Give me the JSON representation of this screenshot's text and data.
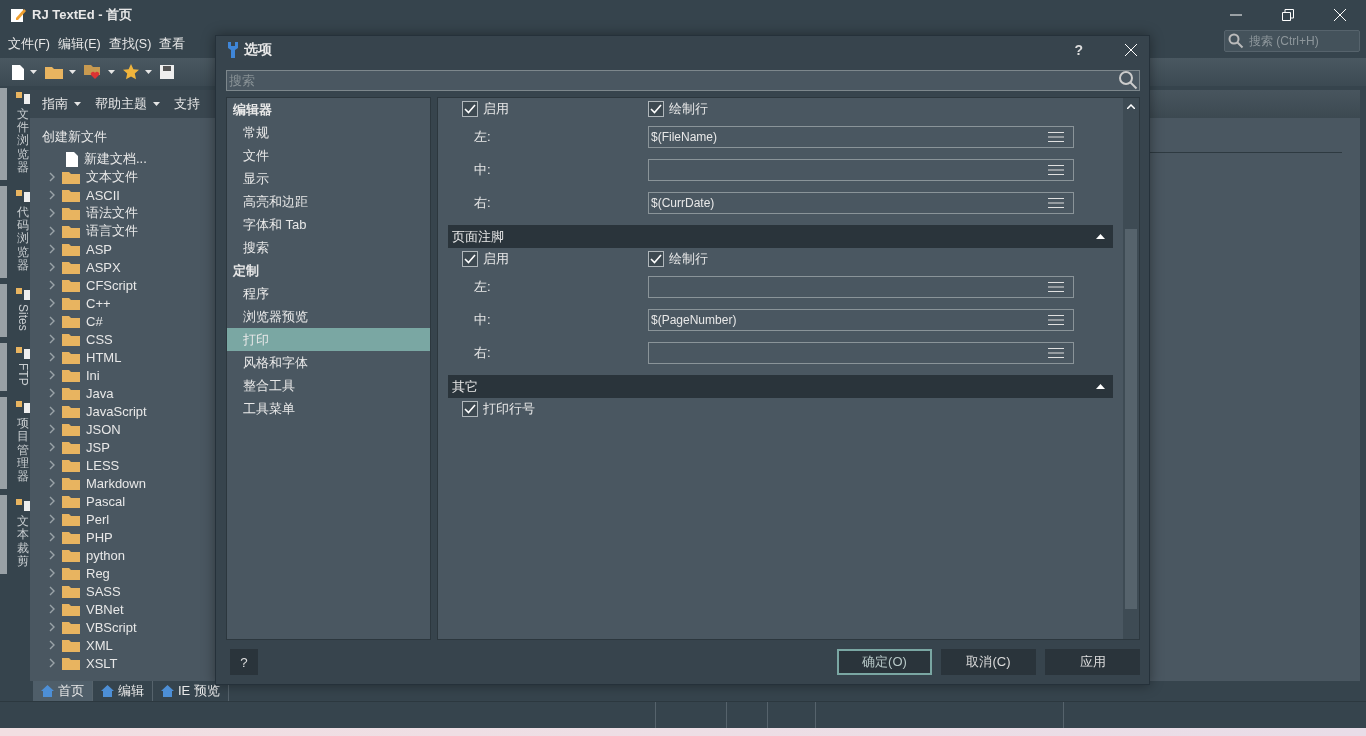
{
  "window": {
    "title": "RJ TextEd - 首页",
    "search_placeholder": "搜索 (Ctrl+H)"
  },
  "menu": [
    "文件(F)",
    "编辑(E)",
    "查找(S)",
    "查看"
  ],
  "side_tabs": [
    {
      "label": "文件浏览器",
      "kind": "cjk"
    },
    {
      "label": "代码浏览器",
      "kind": "cjk"
    },
    {
      "label": "Sites",
      "kind": "latin"
    },
    {
      "label": "FTP",
      "kind": "latin"
    },
    {
      "label": "项目管理器",
      "kind": "cjk"
    },
    {
      "label": "文本裁剪",
      "kind": "cjk"
    }
  ],
  "panel": {
    "toolbar": [
      {
        "label": "指南",
        "dropdown": true
      },
      {
        "label": "帮助主题",
        "dropdown": true
      },
      {
        "label": "支持",
        "dropdown": false
      }
    ],
    "heading": "创建新文件",
    "items": [
      {
        "label": "新建文档...",
        "kind": "file"
      },
      {
        "label": "文本文件",
        "kind": "folder"
      },
      {
        "label": "ASCII",
        "kind": "folder"
      },
      {
        "label": "语法文件",
        "kind": "folder"
      },
      {
        "label": "语言文件",
        "kind": "folder"
      },
      {
        "label": "ASP",
        "kind": "folder"
      },
      {
        "label": "ASPX",
        "kind": "folder"
      },
      {
        "label": "CFScript",
        "kind": "folder"
      },
      {
        "label": "C++",
        "kind": "folder"
      },
      {
        "label": "C#",
        "kind": "folder"
      },
      {
        "label": "CSS",
        "kind": "folder"
      },
      {
        "label": "HTML",
        "kind": "folder"
      },
      {
        "label": "Ini",
        "kind": "folder"
      },
      {
        "label": "Java",
        "kind": "folder"
      },
      {
        "label": "JavaScript",
        "kind": "folder"
      },
      {
        "label": "JSON",
        "kind": "folder"
      },
      {
        "label": "JSP",
        "kind": "folder"
      },
      {
        "label": "LESS",
        "kind": "folder"
      },
      {
        "label": "Markdown",
        "kind": "folder"
      },
      {
        "label": "Pascal",
        "kind": "folder"
      },
      {
        "label": "Perl",
        "kind": "folder"
      },
      {
        "label": "PHP",
        "kind": "folder"
      },
      {
        "label": "python",
        "kind": "folder"
      },
      {
        "label": "Reg",
        "kind": "folder"
      },
      {
        "label": "SASS",
        "kind": "folder"
      },
      {
        "label": "VBNet",
        "kind": "folder"
      },
      {
        "label": "VBScript",
        "kind": "folder"
      },
      {
        "label": "XML",
        "kind": "folder"
      },
      {
        "label": "XSLT",
        "kind": "folder"
      }
    ]
  },
  "bottom_tabs": [
    {
      "label": "首页",
      "selected": true
    },
    {
      "label": "编辑",
      "selected": false
    },
    {
      "label": "IE 预览",
      "selected": false
    }
  ],
  "dialog": {
    "title": "选项",
    "help": "?",
    "search_placeholder": "搜索",
    "nav": [
      {
        "heading": "编辑器",
        "children": [
          {
            "label": "常规",
            "selected": false
          },
          {
            "label": "文件",
            "selected": false
          },
          {
            "label": "显示",
            "selected": false
          },
          {
            "label": "高亮和边距",
            "selected": false
          },
          {
            "label": "字体和 Tab",
            "selected": false
          },
          {
            "label": "搜索",
            "selected": false
          }
        ]
      },
      {
        "heading": "定制",
        "children": [
          {
            "label": "程序",
            "selected": false
          },
          {
            "label": "浏览器预览",
            "selected": false
          },
          {
            "label": "打印",
            "selected": true
          },
          {
            "label": "风格和字体",
            "selected": false
          },
          {
            "label": "整合工具",
            "selected": false
          },
          {
            "label": "工具菜单",
            "selected": false
          }
        ]
      }
    ],
    "sections": [
      {
        "checks": [
          {
            "label": "启用",
            "checked": true
          },
          {
            "label": "绘制行",
            "checked": true
          }
        ],
        "fields": [
          {
            "label": "左:",
            "value": "$(FileName)"
          },
          {
            "label": "中:"
          },
          {
            "label": "右:",
            "value": "$(CurrDate)"
          }
        ]
      },
      {
        "title": "页面注脚",
        "expanded": true,
        "checks": [
          {
            "label": "启用",
            "checked": true
          },
          {
            "label": "绘制行",
            "checked": true
          }
        ],
        "fields": [
          {
            "label": "左:"
          },
          {
            "label": "中:",
            "value": "$(PageNumber)"
          },
          {
            "label": "右:"
          }
        ]
      },
      {
        "title": "其它",
        "expanded": true,
        "checks": [
          {
            "label": "打印行号",
            "checked": true
          }
        ]
      }
    ],
    "footer_help": "?",
    "buttons": [
      {
        "label": "确定(O)",
        "kind": "default"
      },
      {
        "label": "取消(C)",
        "kind": "normal"
      },
      {
        "label": "应用",
        "kind": "normal"
      }
    ]
  }
}
